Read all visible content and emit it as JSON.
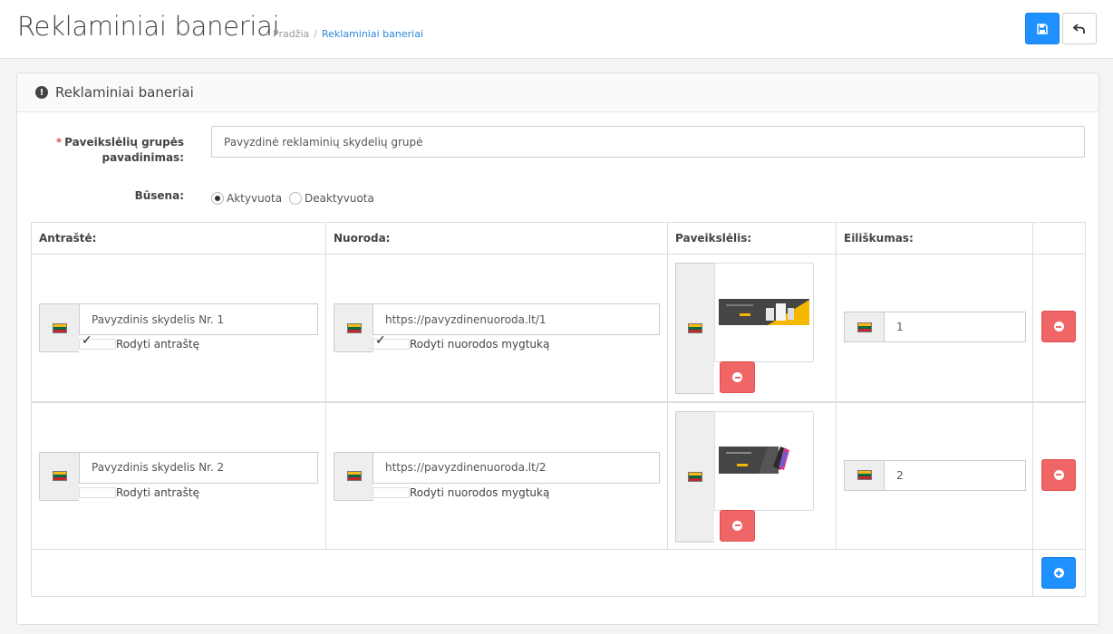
{
  "header": {
    "title": "Reklaminiai baneriai",
    "breadcrumb": [
      "Pradžia",
      "Reklaminiai baneriai"
    ],
    "save_icon": "save-icon",
    "back_icon": "reply-icon"
  },
  "panel": {
    "title": "Reklaminiai baneriai",
    "icon": "exclamation-circle-icon"
  },
  "form": {
    "name_label_line1": "Paveikslėlių grupės",
    "name_label_line2": "pavadinimas:",
    "name_value": "Pavyzdinė reklaminių skydelių grupė",
    "status_label": "Būsena:",
    "status_options": [
      "Aktyvuota",
      "Deaktyvuota"
    ],
    "status_selected": "Aktyvuota"
  },
  "table": {
    "headers": [
      "Antraštė:",
      "Nuoroda:",
      "Paveikslėlis:",
      "Eiliškumas:"
    ],
    "rows": [
      {
        "title": "Pavyzdinis skydelis Nr. 1",
        "show_title_label": "Rodyti antraštę",
        "show_title_checked": true,
        "link": "https://pavyzdinenuoroda.lt/1",
        "show_button_label": "Rodyti nuorodos mygtuką",
        "show_button_checked": true,
        "order": "1"
      },
      {
        "title": "Pavyzdinis skydelis Nr. 2",
        "show_title_label": "Rodyti antraštę",
        "show_title_checked": false,
        "link": "https://pavyzdinenuoroda.lt/2",
        "show_button_label": "Rodyti nuorodos mygtuką",
        "show_button_checked": false,
        "order": "2"
      }
    ]
  },
  "colors": {
    "primary": "#1e90ff",
    "danger": "#f06565",
    "required": "#d9534f"
  }
}
